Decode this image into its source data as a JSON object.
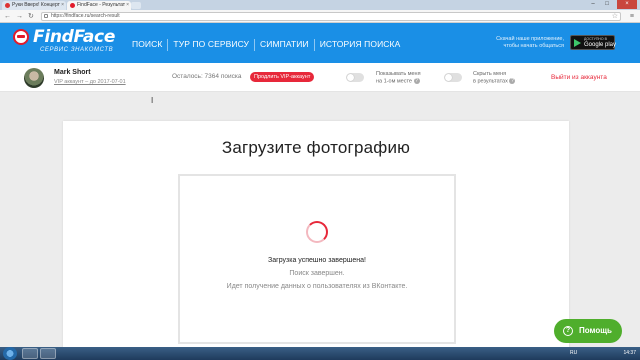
{
  "browser": {
    "tabs": [
      {
        "label": "Руки Вверх! Концерт"
      },
      {
        "label": "FindFace - Результат"
      }
    ],
    "url": "https://findface.ru/search-result"
  },
  "header": {
    "brand": "FindFace",
    "brand_sub": "СЕРВИС ЗНАКОМСТВ",
    "nav": [
      "ПОИСК",
      "ТУР ПО СЕРВИСУ",
      "СИМПАТИИ",
      "ИСТОРИЯ ПОИСКА"
    ],
    "promo_line1": "Скачай наше приложение,",
    "promo_line2": "чтобы начать общаться",
    "gplay_small": "ДОСТУПНО В",
    "gplay_big": "Google play"
  },
  "userbar": {
    "name": "Mark Short",
    "status": "VIP аккаунт – до 2017-07-01",
    "remaining": "Осталось: 7364 поиска",
    "vip_button": "Продлить VIP-аккаунт",
    "toggle1_line1": "Показывать меня",
    "toggle1_line2": "на 1-ом месте",
    "toggle2_line1": "Скрыть меня",
    "toggle2_line2": "в результатах",
    "logout": "Выйти из аккаунта"
  },
  "main": {
    "title": "Загрузите фотографию",
    "status_success": "Загрузка успешно завершена!",
    "status_search": "Поиск завершен.",
    "status_fetch": "Идет получение данных о пользователях из ВКонтакте."
  },
  "help": {
    "label": "Помощь"
  },
  "taskbar": {
    "lang": "RU",
    "clock": "14:37"
  },
  "colors": {
    "brand_blue": "#1a8fe6",
    "accent_red": "#e7283a",
    "help_green": "#4fae2c"
  }
}
